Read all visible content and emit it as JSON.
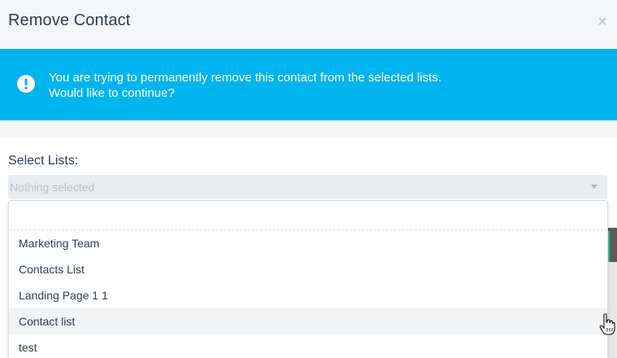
{
  "modal": {
    "title": "Remove Contact",
    "close_label": "×"
  },
  "alert": {
    "line1": "You are trying to permanently remove this contact from the selected lists.",
    "line2": "Would like to continue?",
    "icon": "exclamation-circle-icon",
    "background": "#00b4f0"
  },
  "select": {
    "label": "Select Lists:",
    "value": "Nothing selected"
  },
  "dropdown": {
    "search_value": "",
    "items": [
      {
        "label": "Marketing Team"
      },
      {
        "label": "Contacts List"
      },
      {
        "label": "Landing Page 1 1"
      },
      {
        "label": "Contact list"
      },
      {
        "label": "test"
      }
    ],
    "hovered_index": 3
  }
}
